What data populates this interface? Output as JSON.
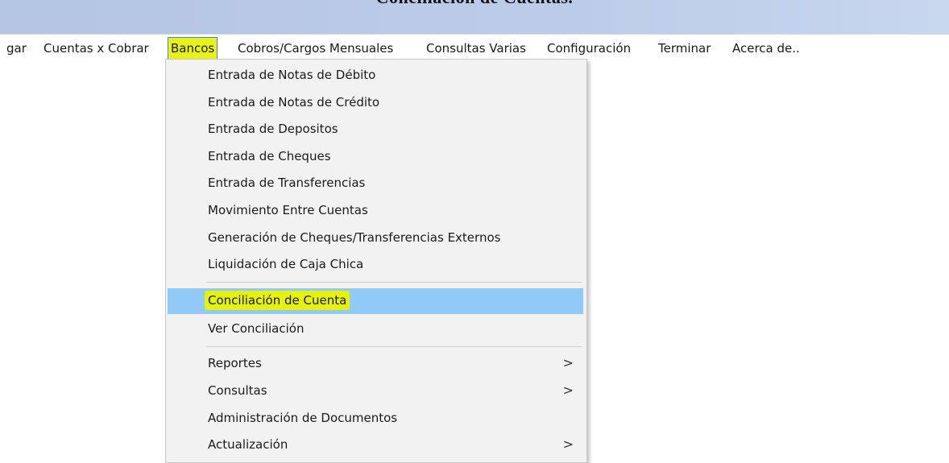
{
  "window": {
    "title": "Conciliación de Cuentas."
  },
  "menubar": {
    "items": [
      {
        "label": "gar"
      },
      {
        "label": "Cuentas x Cobrar"
      },
      {
        "label": "Bancos"
      },
      {
        "label": "Cobros/Cargos Mensuales"
      },
      {
        "label": "Consultas Varias"
      },
      {
        "label": "Configuración"
      },
      {
        "label": "Terminar"
      },
      {
        "label": "Acerca de.."
      }
    ],
    "active_item": "Bancos",
    "highlight_color": "#e8f214"
  },
  "bancos_menu": {
    "items": [
      {
        "label": "Entrada de Notas de Débito"
      },
      {
        "label": "Entrada de Notas de Crédito"
      },
      {
        "label": "Entrada de Depositos"
      },
      {
        "label": "Entrada de Cheques"
      },
      {
        "label": "Entrada de Transferencias"
      },
      {
        "label": "Movimiento Entre Cuentas"
      },
      {
        "label": "Generación de Cheques/Transferencias Externos"
      },
      {
        "label": "Liquidación de Caja Chica"
      },
      {
        "label": "Conciliación de Cuenta"
      },
      {
        "label": "Ver Conciliación"
      },
      {
        "label": "Reportes",
        "submenu_arrow": ">"
      },
      {
        "label": "Consultas",
        "submenu_arrow": ">"
      },
      {
        "label": "Administración de Documentos"
      },
      {
        "label": "Actualización",
        "submenu_arrow": ">"
      }
    ],
    "hovered_item": "Conciliación de Cuenta",
    "hover_color": "#91c9f7"
  }
}
